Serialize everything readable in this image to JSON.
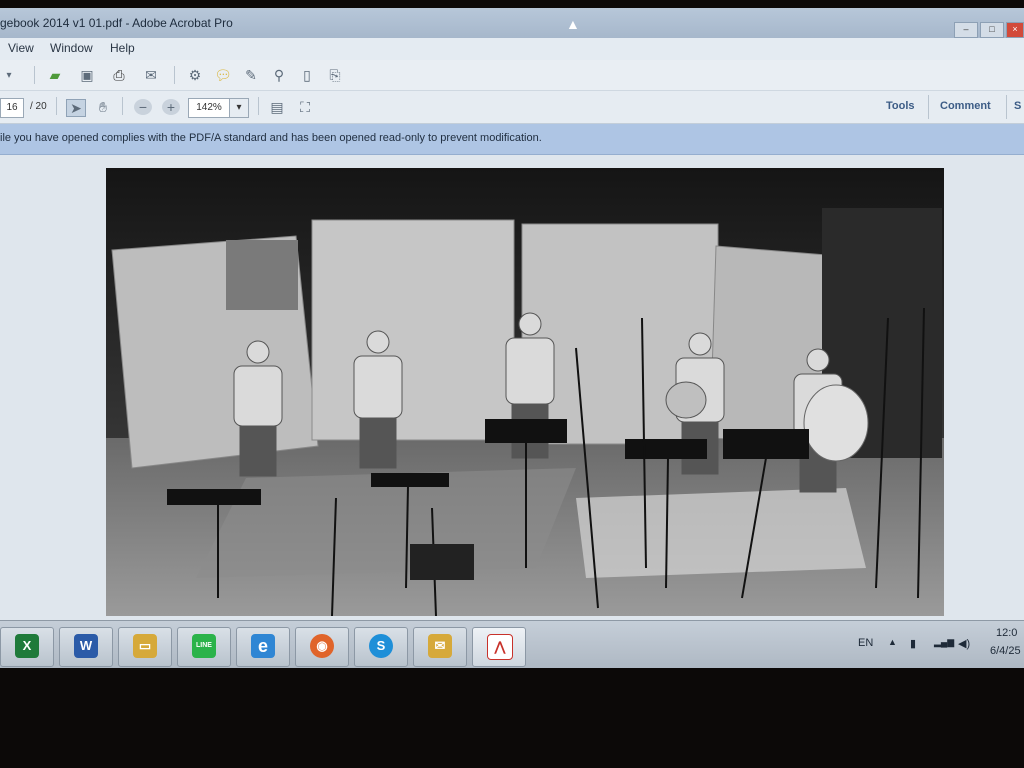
{
  "titlebar": {
    "title": "gebook 2014 v1 01.pdf - Adobe Acrobat Pro"
  },
  "menubar": {
    "items": [
      "View",
      "Window",
      "Help"
    ]
  },
  "toolbar": {
    "page_current": "16",
    "page_total": "/ 20",
    "zoom": "142%",
    "zoom_dropdown": "▾"
  },
  "right_links": {
    "tools": "Tools",
    "comment": "Comment",
    "share": "S"
  },
  "infobar": {
    "message": "ile you have opened complies with the PDF/A standard and has been opened read-only to prevent modification."
  },
  "taskbar": {
    "apps": [
      {
        "name": "excel",
        "glyph": "X",
        "color": "#1f7a3a"
      },
      {
        "name": "word",
        "glyph": "W",
        "color": "#2b5ba8"
      },
      {
        "name": "explorer",
        "glyph": "▭",
        "color": "#d6a93a"
      },
      {
        "name": "line",
        "glyph": "LINE",
        "color": "#2bb34a"
      },
      {
        "name": "ie",
        "glyph": "e",
        "color": "#2f86d4"
      },
      {
        "name": "firefox",
        "glyph": "◉",
        "color": "#e0642a"
      },
      {
        "name": "skype",
        "glyph": "S",
        "color": "#1e8fd8"
      },
      {
        "name": "outlook",
        "glyph": "✉",
        "color": "#d6a93a"
      },
      {
        "name": "acrobat",
        "glyph": "⋀",
        "color": "#c8312a"
      }
    ],
    "lang": "EN",
    "clock_time": "12:0",
    "clock_date": "6/4/25"
  }
}
